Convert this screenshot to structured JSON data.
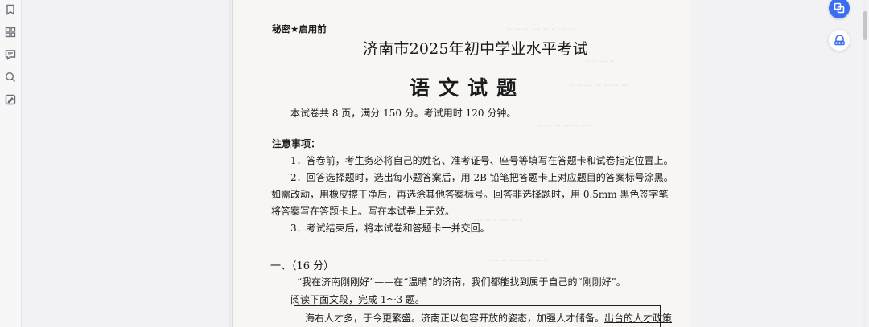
{
  "sidebar": {
    "items": [
      {
        "name": "bookmark-icon"
      },
      {
        "name": "thumbnails-icon"
      },
      {
        "name": "comments-icon"
      },
      {
        "name": "search-icon"
      },
      {
        "name": "annotate-icon"
      }
    ]
  },
  "document": {
    "secret_label": "秘密★启用前",
    "exam_title": "济南市2025年初中学业水平考试",
    "subject": "语文试题",
    "info": "本试卷共 8 页，满分 150 分。考试用时 120 分钟。",
    "notice_heading": "注意事项：",
    "rule1": "1．答卷前，考生务必将自己的姓名、准考证号、座号等填写在答题卡和试卷指定位置上。",
    "rule2_line1": "2．回答选择题时，选出每小题答案后，用 2B 铅笔把答题卡上对应题目的答案标号涂黑。",
    "rule2_line2": "如需改动，用橡皮擦干净后，再选涂其他答案标号。回答非选择题时，用 0.5mm 黑色签字笔",
    "rule2_line3": "将答案写在答题卡上。写在本试卷上无效。",
    "rule3": "3．考试结束后，将本试卷和答题卡一并交回。",
    "section1_heading": "一、（16 分）",
    "section1_lead": "“我在济南刚刚好”——在“温晴”的济南，我们都能找到属于自己的“刚刚好”。",
    "section1_instruction": "阅读下面文段，完成 1～3 题。",
    "passage_start": "海右人才多，于今更繁盛。济南正以包容开放的姿态，加强人才储备。",
    "passage_underlined": "出台的人才政策"
  },
  "colors": {
    "accent": "#3a6df0",
    "page": "#f7f6f3",
    "background": "#f2f2f4"
  },
  "right_tools": [
    {
      "name": "translate-icon"
    },
    {
      "name": "ai-assistant-icon"
    }
  ]
}
